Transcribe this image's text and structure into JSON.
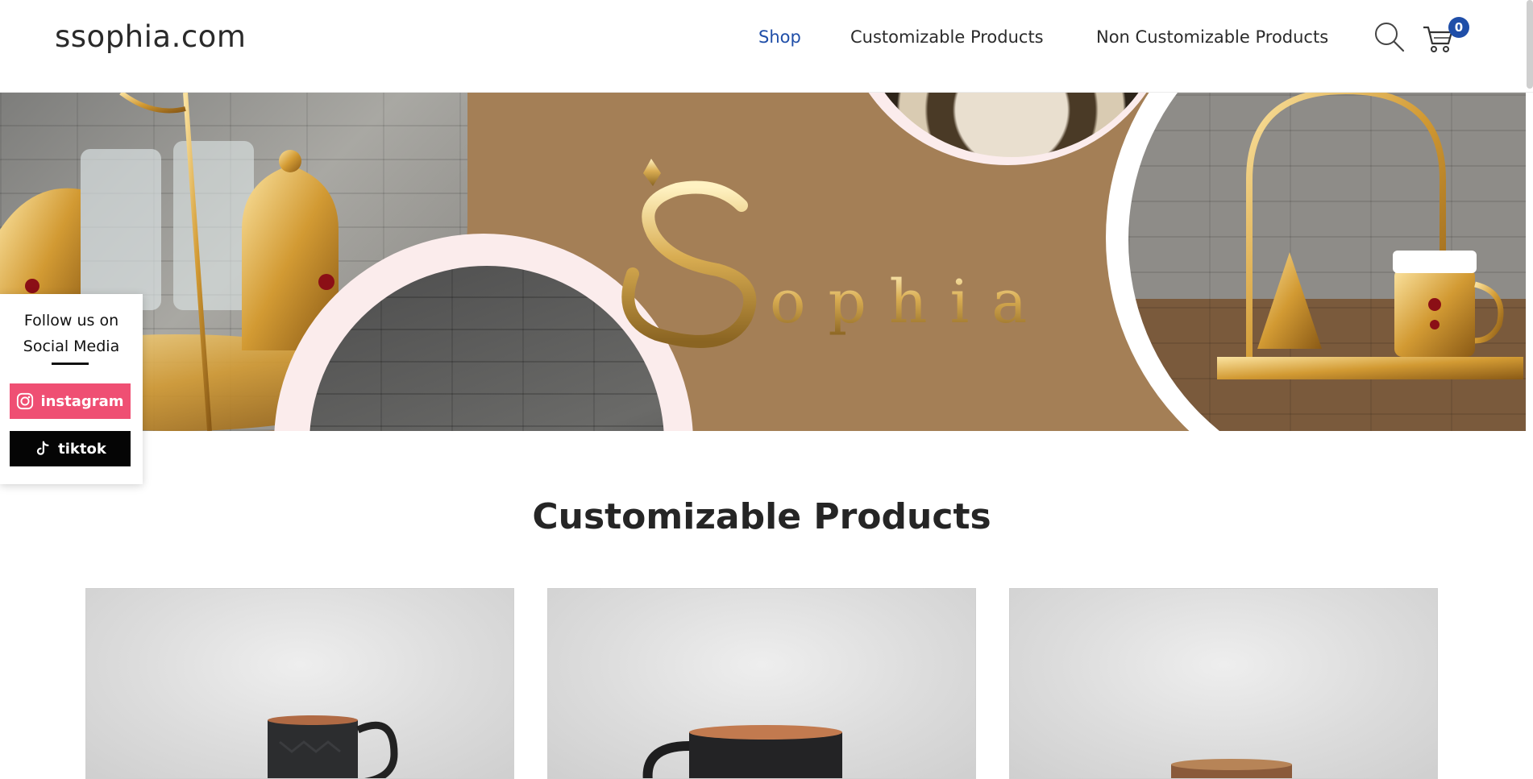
{
  "header": {
    "logo": "ssophia.com",
    "nav": [
      {
        "label": "Shop",
        "active": true
      },
      {
        "label": "Customizable Products",
        "active": false
      },
      {
        "label": "Non Customizable Products",
        "active": false
      }
    ],
    "icons": [
      "search-icon",
      "cart-icon"
    ],
    "cart_count": "0",
    "accent_color": "#1f4ea8"
  },
  "banner": {
    "brand_text": "Sophia",
    "background_color": "#a47f56"
  },
  "social": {
    "title_line1": "Follow us on",
    "title_line2": "Social Media",
    "instagram_label": "instagram",
    "tiktok_label": "tiktok",
    "instagram_color": "#ef4f73",
    "tiktok_color": "#050505"
  },
  "section": {
    "title": "Customizable Products"
  }
}
